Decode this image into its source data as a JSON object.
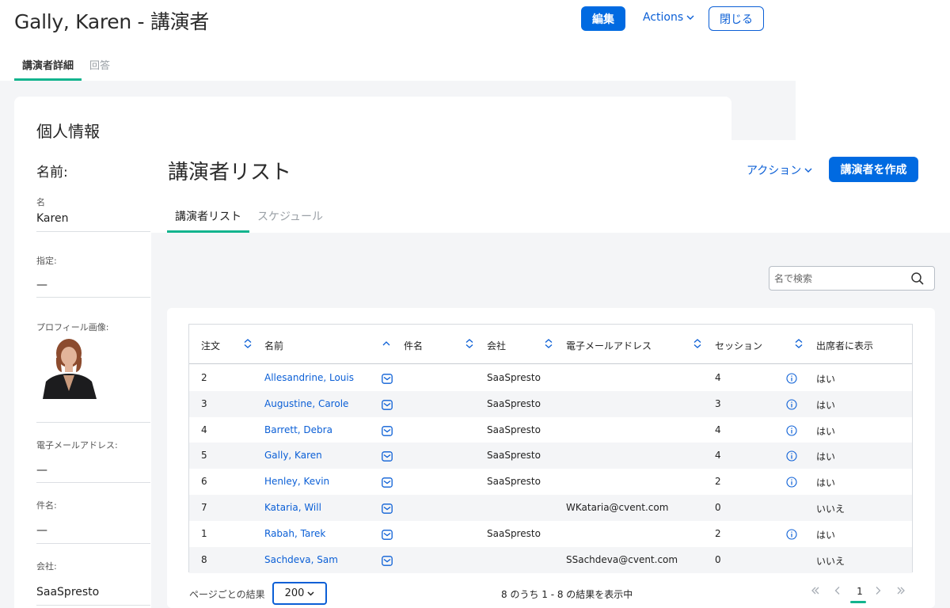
{
  "detail": {
    "title": "Gally, Karen - 講演者",
    "edit_label": "編集",
    "actions_label": "Actions",
    "close_label": "閉じる",
    "tabs": [
      {
        "label": "講演者詳細"
      },
      {
        "label": "回答"
      }
    ],
    "section_title": "個人情報",
    "name_heading": "名前:",
    "fields": {
      "first_name": {
        "label": "名",
        "value": "Karen"
      },
      "designation": {
        "label": "指定:",
        "value": "—"
      },
      "profile_image": {
        "label": "プロフィール画像:"
      },
      "email": {
        "label": "電子メールアドレス:",
        "value": "—"
      },
      "title": {
        "label": "件名:",
        "value": "—"
      },
      "company": {
        "label": "会社:",
        "value": "SaaSpresto"
      }
    }
  },
  "list": {
    "title": "講演者リスト",
    "action_label": "アクション",
    "create_label": "講演者を作成",
    "tabs": [
      {
        "label": "講演者リスト"
      },
      {
        "label": "スケジュール"
      }
    ],
    "search_placeholder": "名で検索",
    "columns": [
      "注文",
      "名前",
      "件名",
      "会社",
      "電子メールアドレス",
      "セッション",
      "出席者に表示"
    ],
    "rows": [
      {
        "order": "2",
        "name": "Allesandrine, Louis",
        "company": "SaaSpresto",
        "email": "",
        "sessions": "4",
        "info": true,
        "show": "はい"
      },
      {
        "order": "3",
        "name": "Augustine, Carole",
        "company": "SaaSpresto",
        "email": "",
        "sessions": "3",
        "info": true,
        "show": "はい"
      },
      {
        "order": "4",
        "name": "Barrett, Debra",
        "company": "SaaSpresto",
        "email": "",
        "sessions": "4",
        "info": true,
        "show": "はい"
      },
      {
        "order": "5",
        "name": "Gally, Karen",
        "company": "SaaSpresto",
        "email": "",
        "sessions": "4",
        "info": true,
        "show": "はい"
      },
      {
        "order": "6",
        "name": "Henley, Kevin",
        "company": "SaaSpresto",
        "email": "",
        "sessions": "2",
        "info": true,
        "show": "はい"
      },
      {
        "order": "7",
        "name": "Kataria, Will",
        "company": "",
        "email": "WKataria@cvent.com",
        "sessions": "0",
        "info": false,
        "show": "いいえ"
      },
      {
        "order": "1",
        "name": "Rabah, Tarek",
        "company": "SaaSpresto",
        "email": "",
        "sessions": "2",
        "info": true,
        "show": "はい"
      },
      {
        "order": "8",
        "name": "Sachdeva, Sam",
        "company": "",
        "email": "SSachdeva@cvent.com",
        "sessions": "0",
        "info": false,
        "show": "いいえ"
      }
    ],
    "pagination": {
      "per_page_label": "ページごとの結果",
      "per_page_value": "200",
      "summary": "8 のうち 1 - 8 の結果を表示中",
      "current_page": "1"
    }
  },
  "colors": {
    "primary": "#006ae1",
    "link": "#0b5fd6",
    "active_tab": "#13b48e"
  }
}
